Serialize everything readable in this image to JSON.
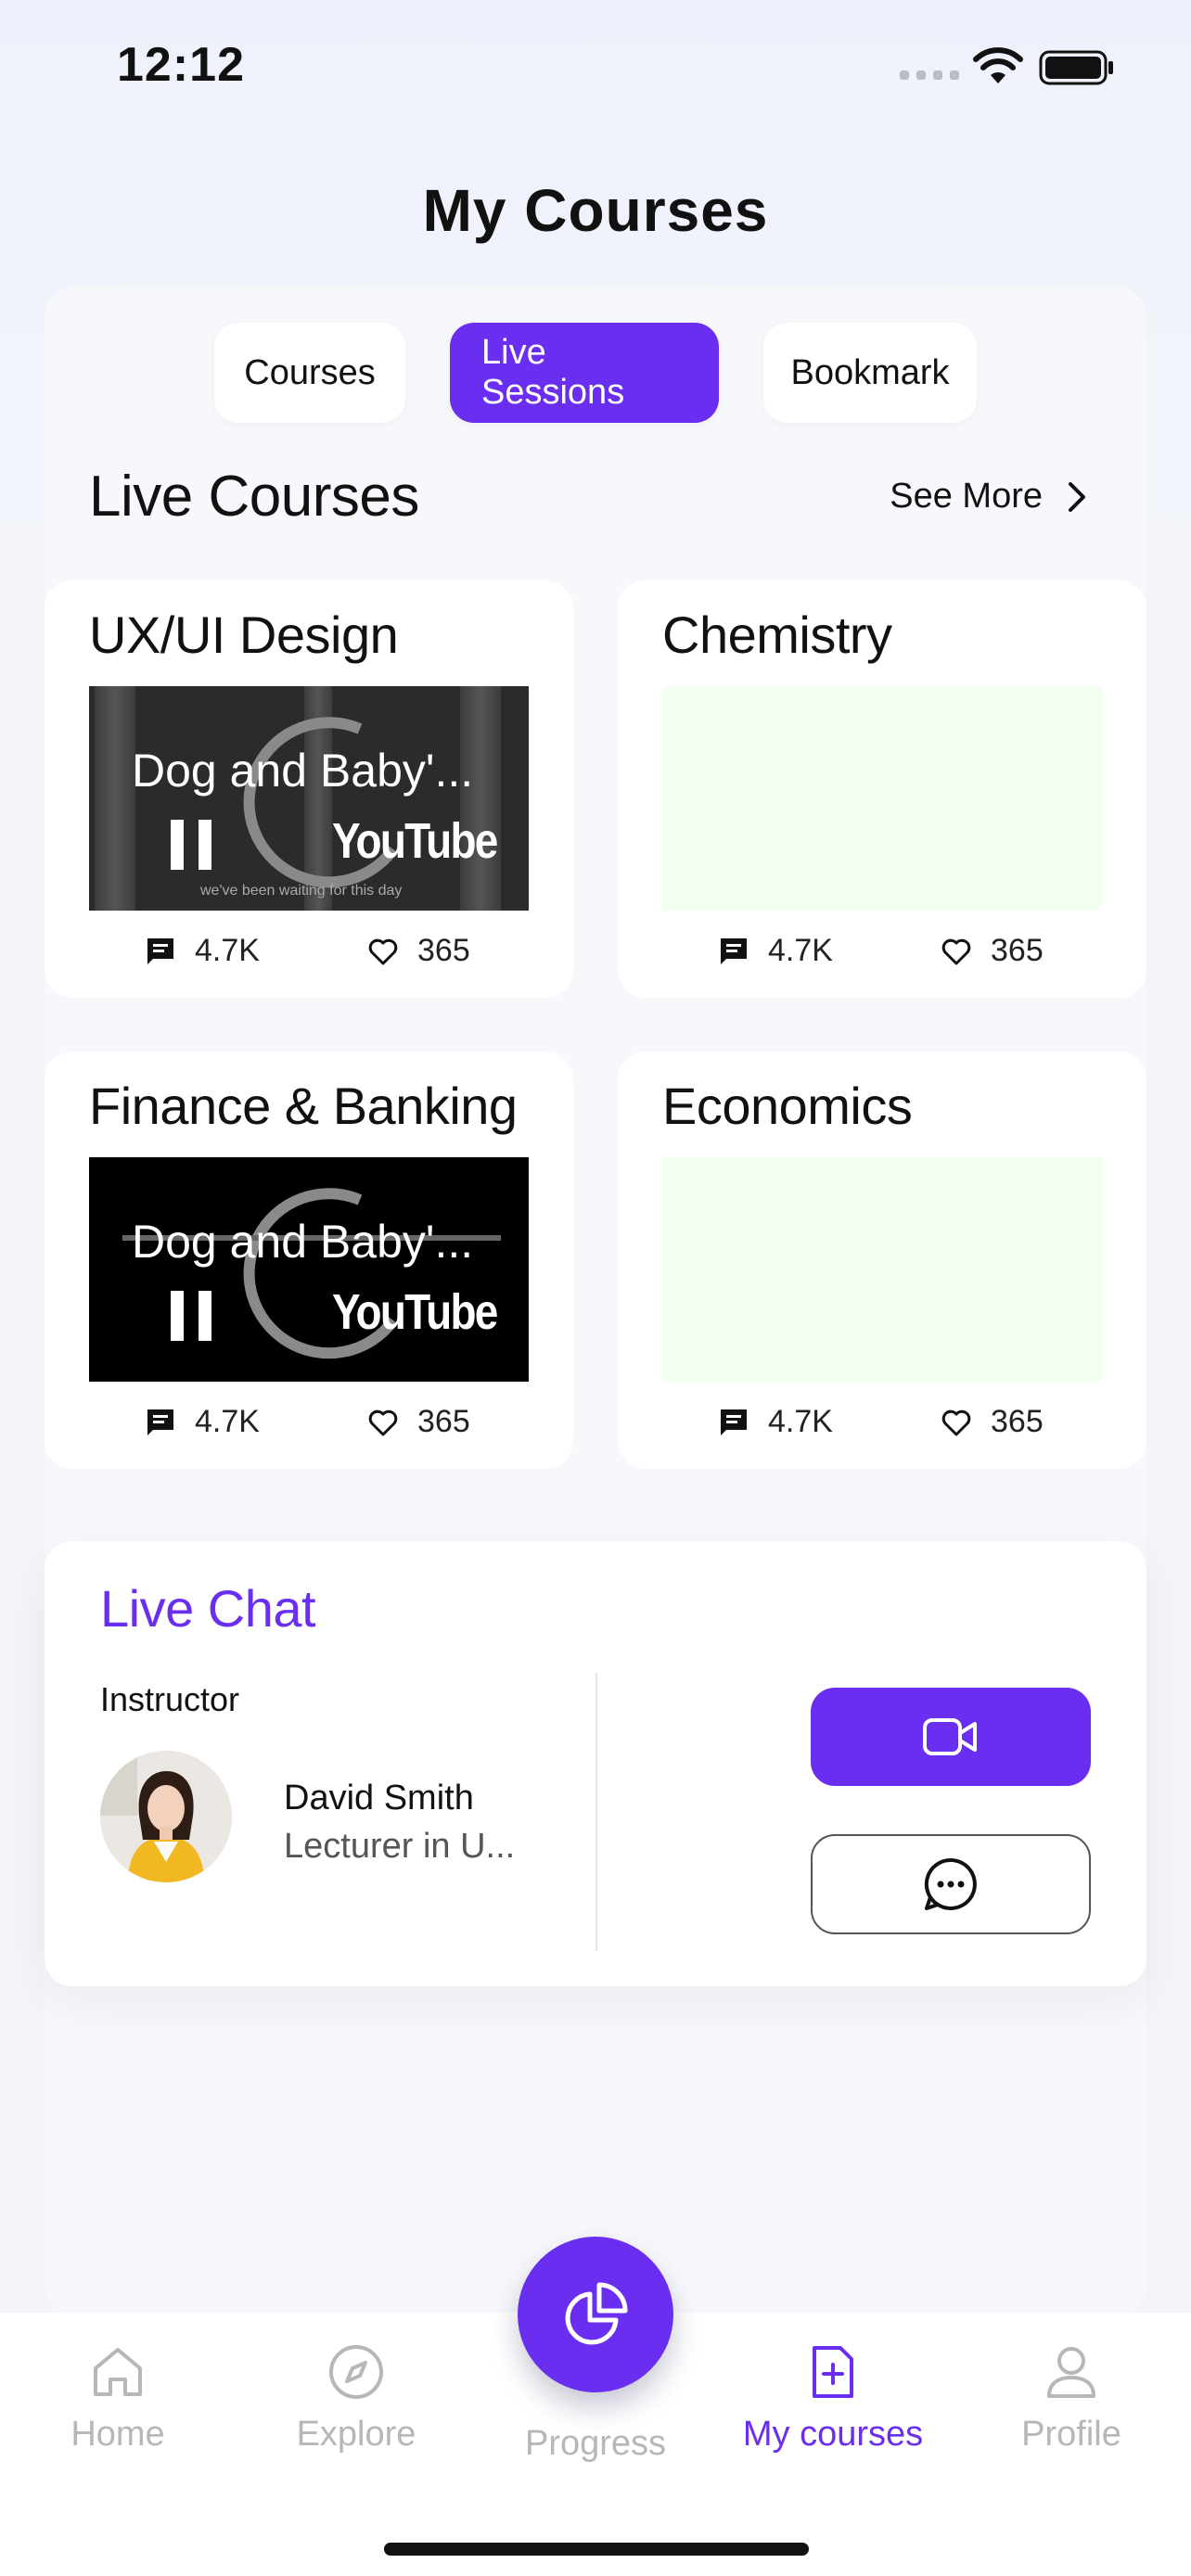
{
  "status": {
    "time": "12:12"
  },
  "header": {
    "title": "My Courses"
  },
  "tabs": [
    {
      "label": "Courses",
      "active": false
    },
    {
      "label": "Live Sessions",
      "active": true
    },
    {
      "label": "Bookmark",
      "active": false
    }
  ],
  "live_courses": {
    "title": "Live Courses",
    "see_more": "See More",
    "cards": [
      {
        "name": "UX/UI Design",
        "video_title": "Dog and Baby'...",
        "video_caption": "we've been waiting for this day",
        "comments": "4.7K",
        "likes": "365"
      },
      {
        "name": "Chemistry",
        "comments": "4.7K",
        "likes": "365"
      },
      {
        "name": "Finance & Banking",
        "video_title": "Dog and Baby'...",
        "comments": "4.7K",
        "likes": "365"
      },
      {
        "name": "Economics",
        "comments": "4.7K",
        "likes": "365"
      }
    ],
    "youtube_label": "YouTube"
  },
  "live_chat": {
    "title": "Live Chat",
    "instructor_label": "Instructor",
    "instructor_name": "David Smith",
    "instructor_role": "Lecturer in U..."
  },
  "bottom_nav": {
    "items": [
      {
        "label": "Home",
        "icon": "home-icon",
        "active": false
      },
      {
        "label": "Explore",
        "icon": "compass-icon",
        "active": false
      },
      {
        "label": "Progress",
        "icon": "pie-chart-icon",
        "active": false
      },
      {
        "label": "My courses",
        "icon": "document-add-icon",
        "active": true
      },
      {
        "label": "Profile",
        "icon": "user-icon",
        "active": false
      }
    ]
  },
  "colors": {
    "accent": "#6a2ef0",
    "inactive": "#b6b6bb",
    "placeholder": "#f3fff0"
  }
}
